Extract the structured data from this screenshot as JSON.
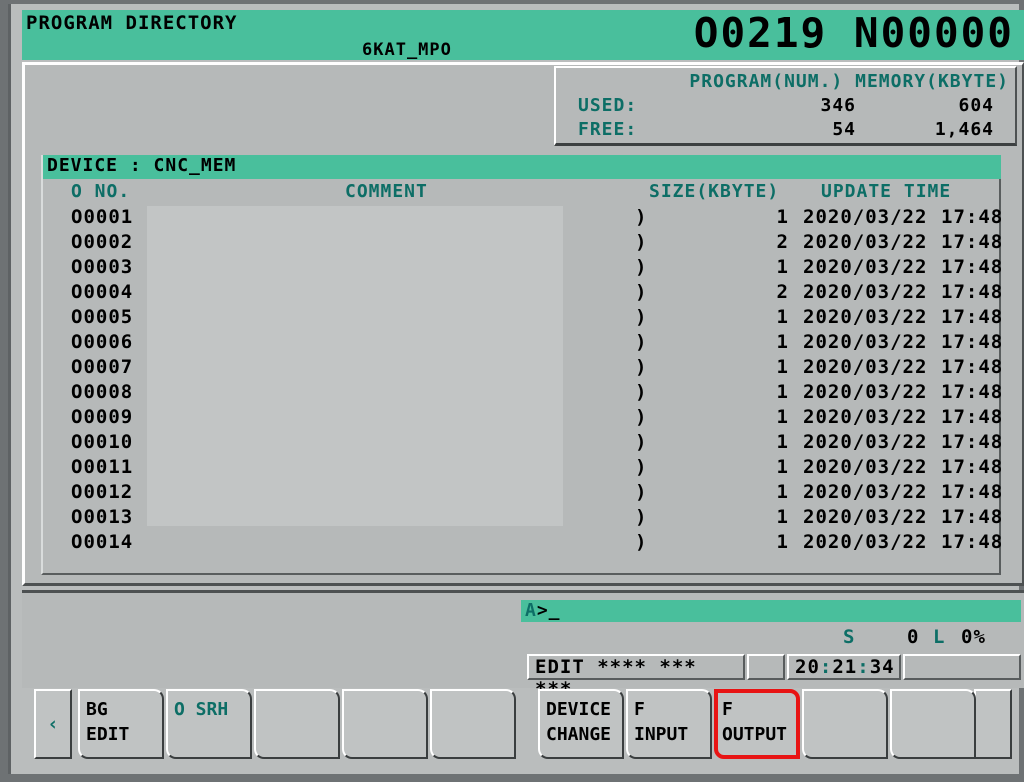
{
  "header": {
    "title": "PROGRAM DIRECTORY",
    "subtitle": "6KAT_MPO",
    "program_number": "O0219 N00000"
  },
  "memory": {
    "col_header": "PROGRAM(NUM.) MEMORY(KBYTE)",
    "used_label": "USED:",
    "used_programs": "346",
    "used_memory": "604",
    "free_label": "FREE:",
    "free_programs": "54",
    "free_memory": "1,464"
  },
  "device": {
    "bar_label": "DEVICE : CNC_MEM"
  },
  "list": {
    "columns": {
      "o_no": "O NO.",
      "comment": "COMMENT",
      "size": "SIZE(KBYTE)",
      "update_time": "UPDATE TIME"
    },
    "rows": [
      {
        "o_no": "O0001",
        "comment": ")",
        "size": "1",
        "date": "2020/03/22",
        "time": "17:48"
      },
      {
        "o_no": "O0002",
        "comment": ")",
        "size": "2",
        "date": "2020/03/22",
        "time": "17:48"
      },
      {
        "o_no": "O0003",
        "comment": ")",
        "size": "1",
        "date": "2020/03/22",
        "time": "17:48"
      },
      {
        "o_no": "O0004",
        "comment": ")",
        "size": "2",
        "date": "2020/03/22",
        "time": "17:48"
      },
      {
        "o_no": "O0005",
        "comment": ")",
        "size": "1",
        "date": "2020/03/22",
        "time": "17:48"
      },
      {
        "o_no": "O0006",
        "comment": ")",
        "size": "1",
        "date": "2020/03/22",
        "time": "17:48"
      },
      {
        "o_no": "O0007",
        "comment": ")",
        "size": "1",
        "date": "2020/03/22",
        "time": "17:48"
      },
      {
        "o_no": "O0008",
        "comment": ")",
        "size": "1",
        "date": "2020/03/22",
        "time": "17:48"
      },
      {
        "o_no": "O0009",
        "comment": ")",
        "size": "1",
        "date": "2020/03/22",
        "time": "17:48"
      },
      {
        "o_no": "O0010",
        "comment": ")",
        "size": "1",
        "date": "2020/03/22",
        "time": "17:48"
      },
      {
        "o_no": "O0011",
        "comment": ")",
        "size": "1",
        "date": "2020/03/22",
        "time": "17:48"
      },
      {
        "o_no": "O0012",
        "comment": ")",
        "size": "1",
        "date": "2020/03/22",
        "time": "17:48"
      },
      {
        "o_no": "O0013",
        "comment": ")",
        "size": "1",
        "date": "2020/03/22",
        "time": "17:48"
      },
      {
        "o_no": "O0014",
        "comment": ")",
        "size": "1",
        "date": "2020/03/22",
        "time": "17:48"
      }
    ]
  },
  "command_line": {
    "device_letter": "A",
    "prompt": ">_"
  },
  "status": {
    "s_label": "S",
    "s_value": "0",
    "l_label": "L",
    "l_value": "0%",
    "mode": "EDIT **** *** ***",
    "spare": "",
    "clock_h": "20",
    "clock_m": "21",
    "clock_s": "34",
    "spare2": ""
  },
  "softkeys": {
    "prev_icon": "‹",
    "next_icon": "",
    "keys": [
      {
        "line1": "BG",
        "line2": "EDIT",
        "teal": false,
        "selected": false
      },
      {
        "line1": "O SRH",
        "line2": "",
        "teal": true,
        "selected": false
      },
      {
        "line1": "",
        "line2": "",
        "teal": false,
        "selected": false
      },
      {
        "line1": "",
        "line2": "",
        "teal": false,
        "selected": false
      },
      {
        "line1": "",
        "line2": "",
        "teal": false,
        "selected": false
      },
      {
        "line1": "DEVICE",
        "line2": "CHANGE",
        "teal": false,
        "selected": false
      },
      {
        "line1": "F",
        "line2": "INPUT",
        "teal": false,
        "selected": false
      },
      {
        "line1": "F",
        "line2": "OUTPUT",
        "teal": false,
        "selected": true
      },
      {
        "line1": "",
        "line2": "",
        "teal": false,
        "selected": false
      },
      {
        "line1": "",
        "line2": "",
        "teal": false,
        "selected": false
      }
    ]
  },
  "colors": {
    "accent_teal": "#49bf9c",
    "text_teal": "#0d6e66",
    "panel_gray": "#b6b9b9",
    "select_red": "#e81414"
  }
}
